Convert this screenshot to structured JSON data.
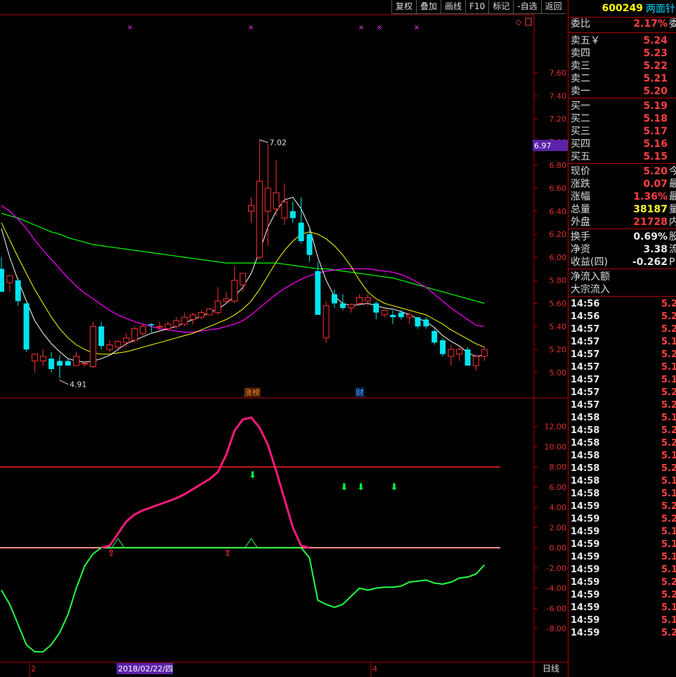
{
  "toolbar": {
    "buttons": [
      "复权",
      "叠加",
      "画线",
      "F10",
      "标记",
      "-自选",
      "返回"
    ]
  },
  "stock": {
    "code": "600249",
    "name": "两面针"
  },
  "quote": {
    "weibi": {
      "label": "委比",
      "value": "2.17%",
      "ext": "委"
    },
    "asks": [
      {
        "label": "卖五￥",
        "price": "5.24"
      },
      {
        "label": "卖四",
        "price": "5.23"
      },
      {
        "label": "卖三",
        "price": "5.22"
      },
      {
        "label": "卖二",
        "price": "5.21"
      },
      {
        "label": "卖一",
        "price": "5.20"
      }
    ],
    "bids": [
      {
        "label": "买一",
        "price": "5.19"
      },
      {
        "label": "买二",
        "price": "5.18"
      },
      {
        "label": "买三",
        "price": "5.17"
      },
      {
        "label": "买四",
        "price": "5.16"
      },
      {
        "label": "买五",
        "price": "5.15"
      }
    ],
    "stats1": [
      {
        "label": "现价",
        "value": "5.20",
        "color": "red",
        "ext": "今"
      },
      {
        "label": "涨跌",
        "value": "0.07",
        "color": "red",
        "ext": "最"
      },
      {
        "label": "涨幅",
        "value": "1.36%",
        "color": "red",
        "ext": "最"
      },
      {
        "label": "总量",
        "value": "38187",
        "color": "yellow",
        "ext": "量"
      },
      {
        "label": "外盘",
        "value": "21728",
        "color": "red",
        "ext": "内"
      }
    ],
    "stats2": [
      {
        "label": "换手",
        "value": "0.69%",
        "color": "white",
        "ext": "股"
      },
      {
        "label": "净资",
        "value": "3.38",
        "color": "white",
        "ext": "流"
      },
      {
        "label": "收益(四)",
        "value": "-0.262",
        "color": "white",
        "ext": "P"
      }
    ],
    "flow": [
      {
        "label": "净流入额"
      },
      {
        "label": "大宗流入"
      }
    ]
  },
  "ticks": [
    {
      "t": "14:56",
      "p": "5.2",
      "c": "r"
    },
    {
      "t": "14:56",
      "p": "5.2",
      "c": "r"
    },
    {
      "t": "14:57",
      "p": "5.2",
      "c": "r"
    },
    {
      "t": "14:57",
      "p": "5.1",
      "c": "r"
    },
    {
      "t": "14:57",
      "p": "5.2",
      "c": "r"
    },
    {
      "t": "14:57",
      "p": "5.1",
      "c": "r"
    },
    {
      "t": "14:57",
      "p": "5.1",
      "c": "r"
    },
    {
      "t": "14:57",
      "p": "5.2",
      "c": "r"
    },
    {
      "t": "14:57",
      "p": "5.2",
      "c": "r"
    },
    {
      "t": "14:58",
      "p": "5.1",
      "c": "r"
    },
    {
      "t": "14:58",
      "p": "5.2",
      "c": "r"
    },
    {
      "t": "14:58",
      "p": "5.2",
      "c": "r"
    },
    {
      "t": "14:58",
      "p": "5.1",
      "c": "r"
    },
    {
      "t": "14:58",
      "p": "5.2",
      "c": "r"
    },
    {
      "t": "14:58",
      "p": "5.1",
      "c": "r"
    },
    {
      "t": "14:58",
      "p": "5.1",
      "c": "r"
    },
    {
      "t": "14:59",
      "p": "5.2",
      "c": "r"
    },
    {
      "t": "14:59",
      "p": "5.2",
      "c": "r"
    },
    {
      "t": "14:59",
      "p": "5.1",
      "c": "r"
    },
    {
      "t": "14:59",
      "p": "5.1",
      "c": "r"
    },
    {
      "t": "14:59",
      "p": "5.1",
      "c": "r"
    },
    {
      "t": "14:59",
      "p": "5.1",
      "c": "r"
    },
    {
      "t": "14:59",
      "p": "5.2",
      "c": "r"
    },
    {
      "t": "14:59",
      "p": "5.2",
      "c": "r"
    },
    {
      "t": "14:59",
      "p": "5.1",
      "c": "r"
    },
    {
      "t": "14:59",
      "p": "5.1",
      "c": "r"
    },
    {
      "t": "14:59",
      "p": "5.2",
      "c": "r"
    }
  ],
  "colors": {
    "up": "#ff3030",
    "down": "#00e5ee",
    "ma5": "#ffffff",
    "ma10": "#ffff00",
    "ma20": "#ff00ff",
    "ma60": "#00ff00",
    "indicator_pink": "#ff1a7a",
    "indicator_green": "#22ff44",
    "level_line": "#ff2020"
  },
  "chart_data": [
    {
      "type": "candlestick",
      "title": "",
      "ylim": [
        4.92,
        7.86
      ],
      "y_ticks": [
        "7.60",
        "7.40",
        "7.20",
        "7.00",
        "6.80",
        "6.60",
        "6.40",
        "6.20",
        "6.00",
        "5.80",
        "5.60",
        "5.40",
        "5.20",
        "5.00"
      ],
      "current_price_tag": "6.97",
      "annotations": {
        "high": "7.02",
        "low": "4.91"
      },
      "event_tags": [
        "涨榜",
        "财"
      ],
      "candles": [
        {
          "o": 5.9,
          "h": 6.0,
          "l": 5.75,
          "c": 5.7
        },
        {
          "o": 5.78,
          "h": 5.84,
          "l": 5.7,
          "c": 5.84
        },
        {
          "o": 5.8,
          "h": 5.82,
          "l": 5.58,
          "c": 5.62
        },
        {
          "o": 5.6,
          "h": 5.6,
          "l": 5.18,
          "c": 5.2
        },
        {
          "o": 5.1,
          "h": 5.16,
          "l": 5.0,
          "c": 5.16
        },
        {
          "o": 5.1,
          "h": 5.2,
          "l": 5.06,
          "c": 5.14
        },
        {
          "o": 5.12,
          "h": 5.18,
          "l": 5.0,
          "c": 5.03
        },
        {
          "o": 5.1,
          "h": 5.15,
          "l": 4.95,
          "c": 5.06
        },
        {
          "o": 5.1,
          "h": 5.12,
          "l": 5.06,
          "c": 5.06
        },
        {
          "o": 5.06,
          "h": 5.18,
          "l": 5.06,
          "c": 5.14
        },
        {
          "o": 5.08,
          "h": 5.09,
          "l": 5.05,
          "c": 5.08
        },
        {
          "o": 5.05,
          "h": 5.44,
          "l": 5.04,
          "c": 5.4
        },
        {
          "o": 5.4,
          "h": 5.44,
          "l": 5.2,
          "c": 5.23
        },
        {
          "o": 5.2,
          "h": 5.28,
          "l": 5.18,
          "c": 5.24
        },
        {
          "o": 5.22,
          "h": 5.28,
          "l": 5.2,
          "c": 5.27
        },
        {
          "o": 5.26,
          "h": 5.34,
          "l": 5.22,
          "c": 5.3
        },
        {
          "o": 5.28,
          "h": 5.4,
          "l": 5.26,
          "c": 5.38
        },
        {
          "o": 5.34,
          "h": 5.42,
          "l": 5.32,
          "c": 5.4
        },
        {
          "o": 5.42,
          "h": 5.43,
          "l": 5.35,
          "c": 5.41
        },
        {
          "o": 5.4,
          "h": 5.44,
          "l": 5.36,
          "c": 5.4
        },
        {
          "o": 5.38,
          "h": 5.44,
          "l": 5.36,
          "c": 5.42
        },
        {
          "o": 5.4,
          "h": 5.48,
          "l": 5.38,
          "c": 5.45
        },
        {
          "o": 5.42,
          "h": 5.52,
          "l": 5.4,
          "c": 5.48
        },
        {
          "o": 5.46,
          "h": 5.52,
          "l": 5.42,
          "c": 5.5
        },
        {
          "o": 5.48,
          "h": 5.54,
          "l": 5.46,
          "c": 5.52
        },
        {
          "o": 5.5,
          "h": 5.56,
          "l": 5.5,
          "c": 5.55
        },
        {
          "o": 5.52,
          "h": 5.74,
          "l": 5.5,
          "c": 5.62
        },
        {
          "o": 5.62,
          "h": 5.7,
          "l": 5.6,
          "c": 5.64
        },
        {
          "o": 5.62,
          "h": 5.92,
          "l": 5.6,
          "c": 5.8
        },
        {
          "o": 5.76,
          "h": 5.86,
          "l": 5.7,
          "c": 5.86
        },
        {
          "o": 6.4,
          "h": 6.52,
          "l": 6.3,
          "c": 6.45
        },
        {
          "o": 6.0,
          "h": 7.02,
          "l": 5.98,
          "c": 6.66
        },
        {
          "o": 6.4,
          "h": 6.98,
          "l": 6.1,
          "c": 6.6
        },
        {
          "o": 6.42,
          "h": 6.84,
          "l": 6.36,
          "c": 6.56
        },
        {
          "o": 6.34,
          "h": 6.64,
          "l": 6.28,
          "c": 6.48
        },
        {
          "o": 6.4,
          "h": 6.48,
          "l": 6.3,
          "c": 6.34
        },
        {
          "o": 6.3,
          "h": 6.52,
          "l": 6.12,
          "c": 6.14
        },
        {
          "o": 6.2,
          "h": 6.24,
          "l": 5.96,
          "c": 6.02
        },
        {
          "o": 5.88,
          "h": 5.96,
          "l": 5.5,
          "c": 5.5
        },
        {
          "o": 5.3,
          "h": 5.62,
          "l": 5.26,
          "c": 5.58
        },
        {
          "o": 5.68,
          "h": 5.72,
          "l": 5.56,
          "c": 5.6
        },
        {
          "o": 5.6,
          "h": 5.68,
          "l": 5.54,
          "c": 5.56
        },
        {
          "o": 5.56,
          "h": 5.6,
          "l": 5.52,
          "c": 5.59
        },
        {
          "o": 5.6,
          "h": 5.68,
          "l": 5.58,
          "c": 5.65
        },
        {
          "o": 5.62,
          "h": 5.68,
          "l": 5.58,
          "c": 5.65
        },
        {
          "o": 5.6,
          "h": 5.62,
          "l": 5.46,
          "c": 5.52
        },
        {
          "o": 5.5,
          "h": 5.54,
          "l": 5.48,
          "c": 5.54
        },
        {
          "o": 5.5,
          "h": 5.54,
          "l": 5.42,
          "c": 5.48
        },
        {
          "o": 5.52,
          "h": 5.54,
          "l": 5.46,
          "c": 5.48
        },
        {
          "o": 5.48,
          "h": 5.52,
          "l": 5.42,
          "c": 5.5
        },
        {
          "o": 5.48,
          "h": 5.48,
          "l": 5.38,
          "c": 5.4
        },
        {
          "o": 5.46,
          "h": 5.48,
          "l": 5.38,
          "c": 5.4
        },
        {
          "o": 5.36,
          "h": 5.38,
          "l": 5.24,
          "c": 5.26
        },
        {
          "o": 5.28,
          "h": 5.3,
          "l": 5.14,
          "c": 5.16
        },
        {
          "o": 5.14,
          "h": 5.24,
          "l": 5.06,
          "c": 5.2
        },
        {
          "o": 5.16,
          "h": 5.22,
          "l": 5.1,
          "c": 5.2
        },
        {
          "o": 5.2,
          "h": 5.22,
          "l": 5.06,
          "c": 5.06
        },
        {
          "o": 5.06,
          "h": 5.16,
          "l": 5.02,
          "c": 5.14
        },
        {
          "o": 5.14,
          "h": 5.22,
          "l": 5.1,
          "c": 5.2
        }
      ],
      "ma5": [
        6.25,
        6.0,
        5.8,
        5.62,
        5.45,
        5.34,
        5.25,
        5.18,
        5.12,
        5.1,
        5.09,
        5.1,
        5.12,
        5.15,
        5.2,
        5.25,
        5.28,
        5.31,
        5.34,
        5.36,
        5.38,
        5.4,
        5.43,
        5.46,
        5.49,
        5.52,
        5.55,
        5.6,
        5.66,
        5.74,
        5.86,
        6.05,
        6.26,
        6.4,
        6.5,
        6.52,
        6.42,
        6.26,
        6.0,
        5.8,
        5.66,
        5.6,
        5.58,
        5.59,
        5.6,
        5.58,
        5.56,
        5.55,
        5.53,
        5.5,
        5.47,
        5.44,
        5.39,
        5.32,
        5.27,
        5.23,
        5.17,
        5.14,
        5.15
      ],
      "ma10": [
        6.3,
        6.15,
        6.0,
        5.86,
        5.72,
        5.6,
        5.48,
        5.38,
        5.3,
        5.24,
        5.2,
        5.17,
        5.16,
        5.16,
        5.17,
        5.18,
        5.2,
        5.22,
        5.24,
        5.26,
        5.28,
        5.3,
        5.32,
        5.34,
        5.37,
        5.4,
        5.43,
        5.46,
        5.5,
        5.55,
        5.62,
        5.72,
        5.84,
        5.96,
        6.06,
        6.14,
        6.2,
        6.22,
        6.2,
        6.16,
        6.1,
        6.02,
        5.92,
        5.8,
        5.7,
        5.64,
        5.6,
        5.58,
        5.56,
        5.54,
        5.52,
        5.5,
        5.46,
        5.42,
        5.37,
        5.33,
        5.29,
        5.25,
        5.22
      ],
      "ma20": [
        6.45,
        6.4,
        6.33,
        6.25,
        6.15,
        6.06,
        5.98,
        5.9,
        5.82,
        5.75,
        5.69,
        5.64,
        5.59,
        5.54,
        5.5,
        5.47,
        5.44,
        5.42,
        5.4,
        5.38,
        5.37,
        5.36,
        5.35,
        5.35,
        5.36,
        5.37,
        5.38,
        5.4,
        5.42,
        5.45,
        5.5,
        5.56,
        5.62,
        5.68,
        5.73,
        5.77,
        5.81,
        5.84,
        5.86,
        5.88,
        5.89,
        5.9,
        5.9,
        5.9,
        5.9,
        5.89,
        5.88,
        5.87,
        5.85,
        5.82,
        5.78,
        5.74,
        5.68,
        5.62,
        5.56,
        5.51,
        5.46,
        5.41,
        5.4
      ],
      "ma60": [
        6.38,
        6.36,
        6.34,
        6.31,
        6.28,
        6.25,
        6.22,
        6.2,
        6.17,
        6.15,
        6.13,
        6.11,
        6.1,
        6.09,
        6.08,
        6.07,
        6.06,
        6.05,
        6.04,
        6.03,
        6.02,
        6.01,
        6.0,
        5.99,
        5.98,
        5.97,
        5.96,
        5.95,
        5.95,
        5.95,
        5.95,
        5.95,
        5.95,
        5.95,
        5.94,
        5.93,
        5.92,
        5.91,
        5.9,
        5.9,
        5.89,
        5.88,
        5.87,
        5.86,
        5.85,
        5.84,
        5.83,
        5.82,
        5.8,
        5.78,
        5.76,
        5.74,
        5.72,
        5.7,
        5.68,
        5.66,
        5.64,
        5.62,
        5.6
      ]
    },
    {
      "type": "line",
      "title": "",
      "ylim": [
        -10.5,
        14.0
      ],
      "y_ticks": [
        "12.00",
        "10.00",
        "8.00",
        "6.00",
        "4.00",
        "2.00",
        "0.00",
        "-2.00",
        "-4.00",
        "-6.00",
        "-8.00"
      ],
      "level_lines": [
        8,
        0
      ],
      "x_labels": [
        "2",
        "2018/02/22/四",
        "4"
      ],
      "period_label": "日线",
      "pink_series": [
        0,
        0,
        0,
        0,
        0,
        0,
        0,
        0,
        0,
        0,
        0,
        0,
        0,
        0.2,
        1.4,
        2.6,
        3.3,
        3.7,
        4.0,
        4.3,
        4.6,
        4.9,
        5.3,
        5.8,
        6.3,
        6.8,
        7.5,
        9.2,
        11.6,
        12.7,
        12.9,
        11.9,
        10.2,
        7.6,
        4.8,
        2.0,
        0.2,
        0,
        0,
        0,
        0,
        0,
        0,
        0,
        0,
        0,
        0,
        0,
        0,
        0,
        0,
        0,
        0,
        0,
        0,
        0,
        0,
        0,
        0
      ],
      "green_series": [
        -4.2,
        -5.6,
        -7.6,
        -9.6,
        -10.3,
        -10.3,
        -9.6,
        -8.4,
        -6.6,
        -4.0,
        -1.8,
        -0.6,
        0,
        0,
        0,
        0,
        0,
        0,
        0,
        0,
        0,
        0,
        0,
        0,
        0,
        0,
        0,
        0,
        0,
        0,
        0,
        0,
        0,
        0,
        0,
        0,
        0,
        -1.0,
        -5.2,
        -5.6,
        -5.9,
        -5.6,
        -4.8,
        -4.0,
        -4.2,
        -4.0,
        -3.9,
        -3.9,
        -3.8,
        -3.4,
        -3.3,
        -3.2,
        -3.5,
        -3.6,
        -3.4,
        -3.0,
        -2.9,
        -2.6,
        -1.7
      ],
      "up_arrows": [
        13,
        27
      ],
      "down_arrows": [
        30,
        41,
        43,
        47
      ]
    }
  ]
}
